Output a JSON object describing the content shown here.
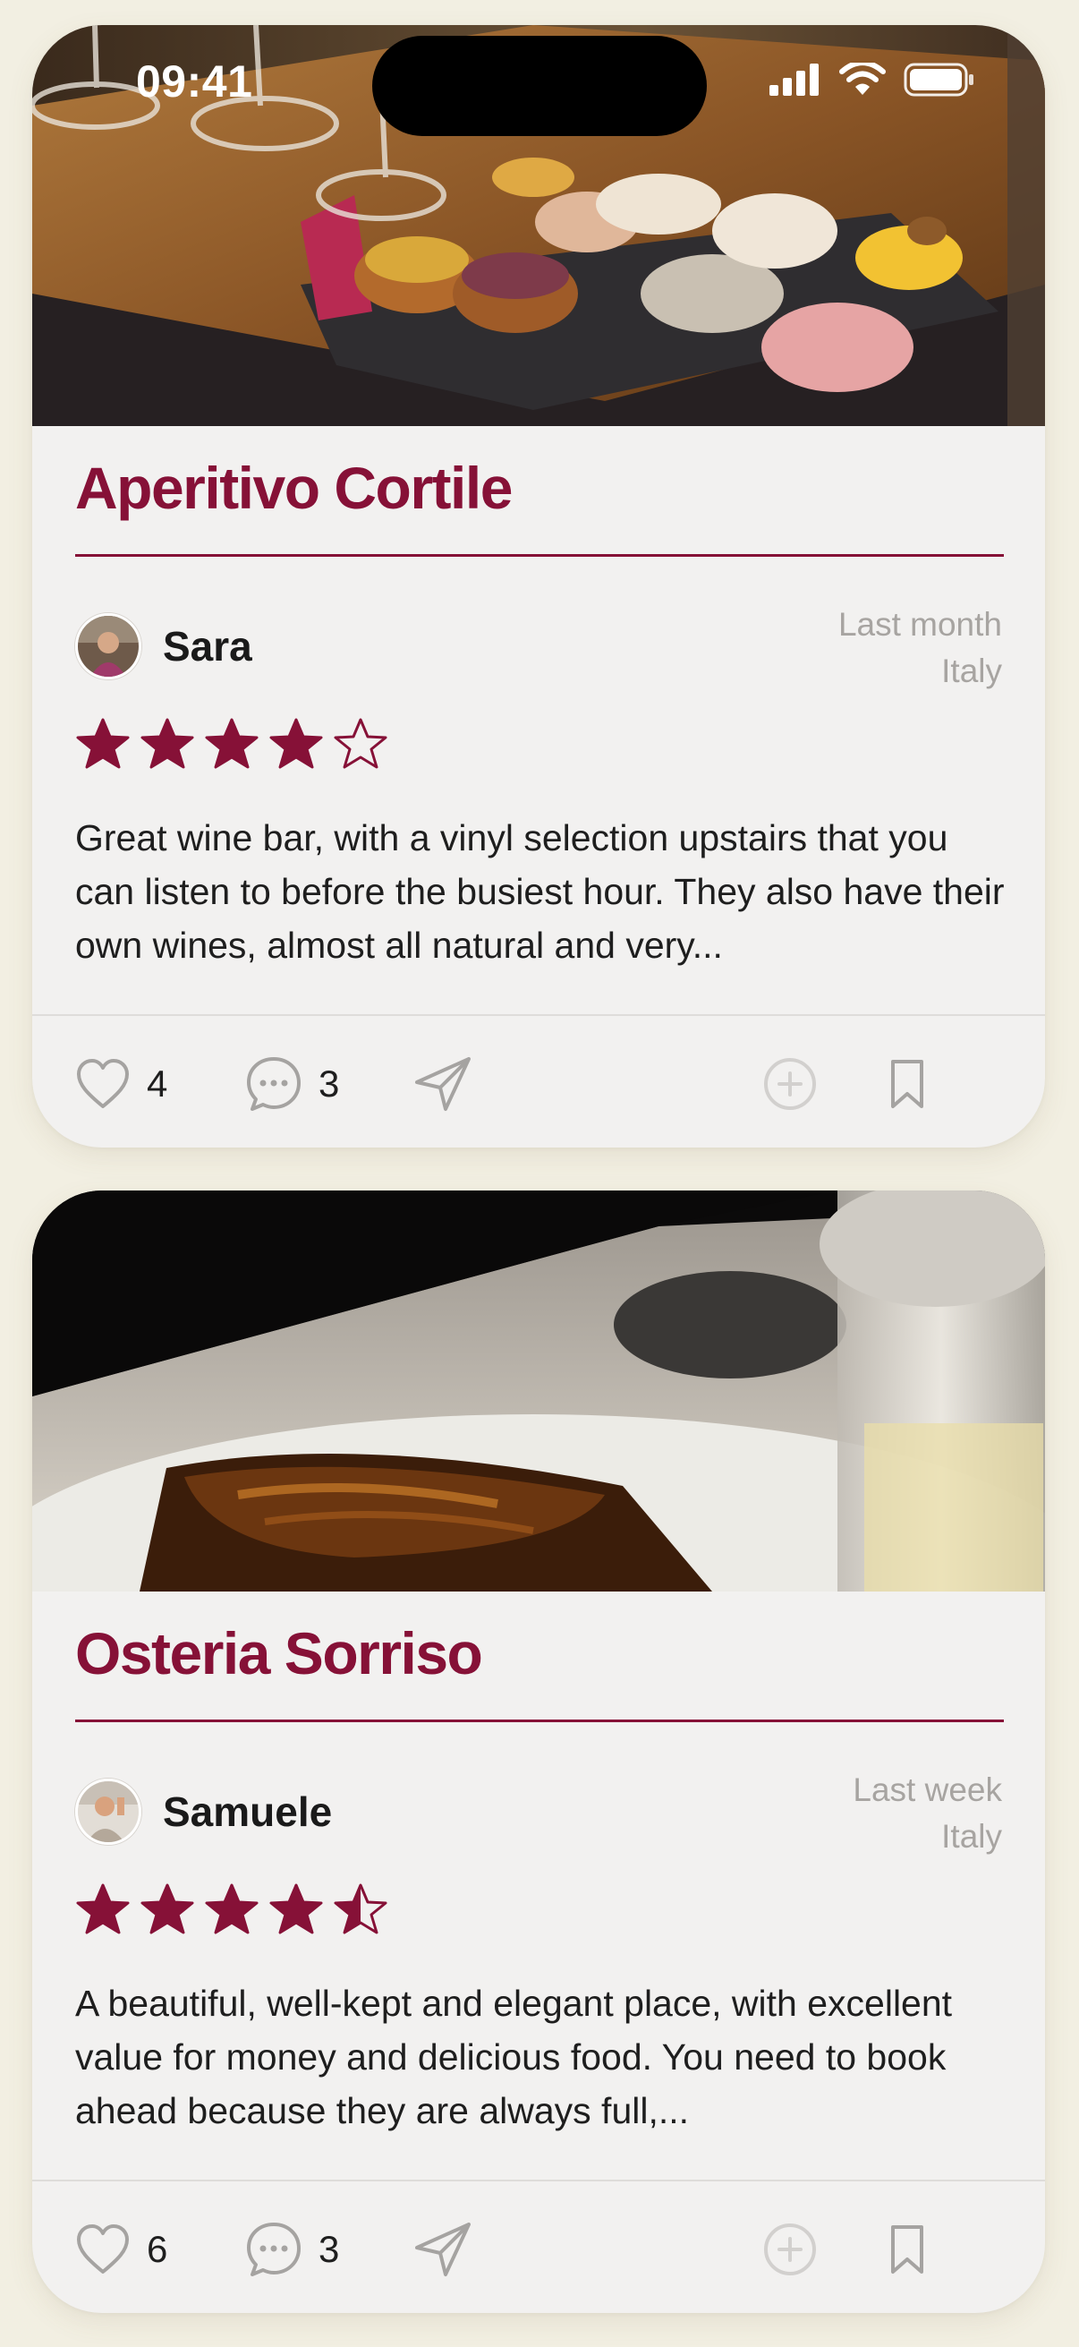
{
  "status_bar": {
    "time": "09:41"
  },
  "colors": {
    "accent": "#861137",
    "background": "#f2efe2",
    "card": "#f2f1f0",
    "muted_text": "#a7a4a1"
  },
  "posts": [
    {
      "title": "Aperitivo Cortile",
      "photo_icon": "food-photo",
      "author": "Sara",
      "time_ago": "Last month",
      "location": "Italy",
      "rating": 4,
      "rating_max": 5,
      "review": "Great wine bar, with a vinyl selection upstairs that you can listen to before the busiest hour. They also have their own wines, almost all natural and very...",
      "likes": "4",
      "comments": "3"
    },
    {
      "title": "Osteria Sorriso",
      "photo_icon": "food-photo",
      "author": "Samuele",
      "time_ago": "Last week",
      "location": "Italy",
      "rating": 4.5,
      "rating_max": 5,
      "review": "A beautiful, well-kept and elegant place, with excellent value for money and delicious food. You need to book ahead because they are always full,...",
      "likes": "6",
      "comments": "3"
    }
  ],
  "icons": {
    "like": "heart-icon",
    "comment": "chat-bubble-icon",
    "share": "paper-plane-icon",
    "add": "plus-circle-icon",
    "save": "bookmark-icon",
    "rating": "star-icon"
  }
}
